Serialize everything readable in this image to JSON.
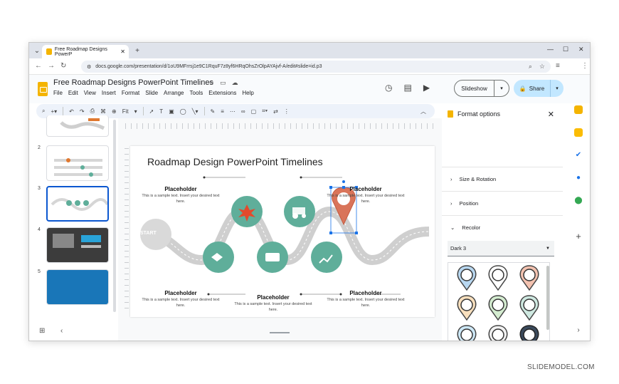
{
  "browser": {
    "tab_title": "Free Roadmap Designs PowerP",
    "url": "docs.google.com/presentation/d/1oU9MFrrsj1e9C1RquF7z8yf6HRqOhsZrOlpAYAjvf-A/edit#slide=id.p3"
  },
  "app": {
    "doc_title": "Free Roadmap Designs PowerPoint Timelines",
    "menu": [
      "File",
      "Edit",
      "View",
      "Insert",
      "Format",
      "Slide",
      "Arrange",
      "Tools",
      "Extensions",
      "Help"
    ],
    "slideshow_label": "Slideshow",
    "share_label": "Share",
    "zoom": "Fit"
  },
  "thumbnails": {
    "numbers": [
      "2",
      "3",
      "4",
      "5"
    ]
  },
  "slide": {
    "title": "Roadmap Design PowerPoint Timelines",
    "start_label": "START",
    "placeholders": [
      {
        "title": "Placeholder",
        "text": "This is a sample text. Insert your desired text here."
      },
      {
        "title": "Placeholder",
        "text": "This is a sample text. Insert your desired text here."
      },
      {
        "title": "Placeholder",
        "text": "This is a sample text. Insert your desired text here."
      },
      {
        "title": "Placeholder",
        "text": "This is a sample text. Insert your desired text here."
      },
      {
        "title": "Placeholder",
        "text": "This is a sample text. Insert your desired text here."
      }
    ]
  },
  "format_panel": {
    "title": "Format options",
    "sections": [
      "Size & Rotation",
      "Position",
      "Recolor"
    ],
    "recolor_value": "Dark 3"
  },
  "watermark": "SLIDEMODEL.COM",
  "colors": {
    "teal": "#5fae9a",
    "pin_red": "#d9745a",
    "road": "#cfcfcf",
    "accent_blue": "#0b57d0"
  }
}
